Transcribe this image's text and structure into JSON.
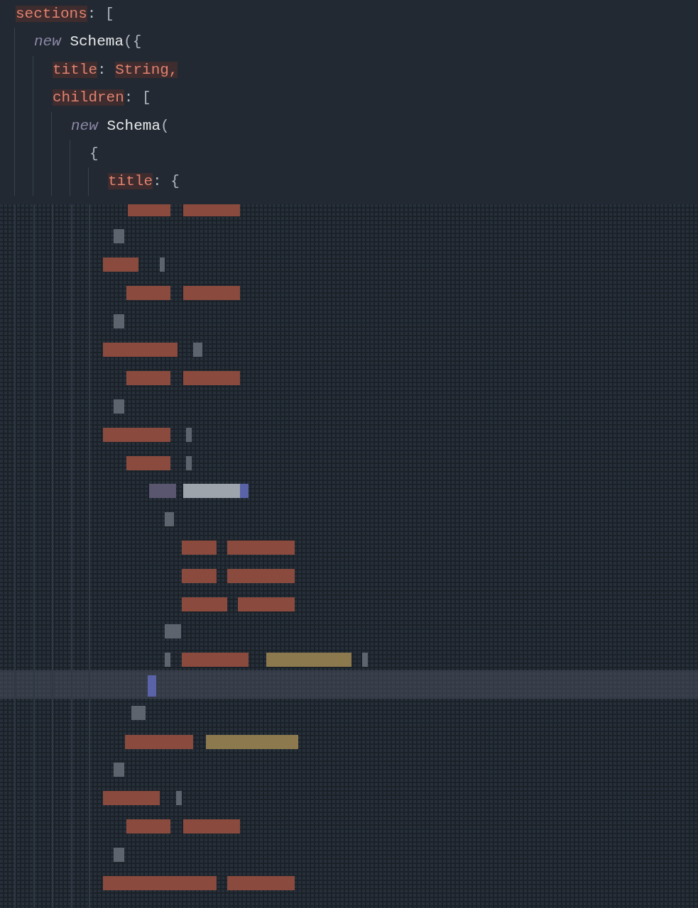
{
  "code": {
    "lines": [
      {
        "tokens": [
          {
            "kind": "key",
            "text": "sections"
          },
          {
            "kind": "punct",
            "text": ": ["
          }
        ],
        "children": [
          {
            "tokens": [
              {
                "kind": "keyword",
                "text": "new"
              },
              {
                "kind": "class",
                "text": " Schema"
              },
              {
                "kind": "punct",
                "text": "({"
              }
            ],
            "children": [
              {
                "tokens": [
                  {
                    "kind": "key",
                    "text": "title"
                  },
                  {
                    "kind": "punct",
                    "text": ": "
                  },
                  {
                    "kind": "type",
                    "text": "String,"
                  }
                ]
              },
              {
                "tokens": [
                  {
                    "kind": "key",
                    "text": "children"
                  },
                  {
                    "kind": "punct",
                    "text": ": ["
                  }
                ],
                "children": [
                  {
                    "tokens": [
                      {
                        "kind": "keyword",
                        "text": "new"
                      },
                      {
                        "kind": "class",
                        "text": " Schema"
                      },
                      {
                        "kind": "punct",
                        "text": "("
                      }
                    ],
                    "children": [
                      {
                        "tokens": [
                          {
                            "kind": "punct",
                            "text": "{"
                          }
                        ],
                        "children": [
                          {
                            "tokens": [
                              {
                                "kind": "key",
                                "text": "title"
                              },
                              {
                                "kind": "punct",
                                "text": ": {"
                              }
                            ]
                          }
                        ]
                      }
                    ]
                  }
                ]
              }
            ]
          }
        ]
      }
    ]
  }
}
